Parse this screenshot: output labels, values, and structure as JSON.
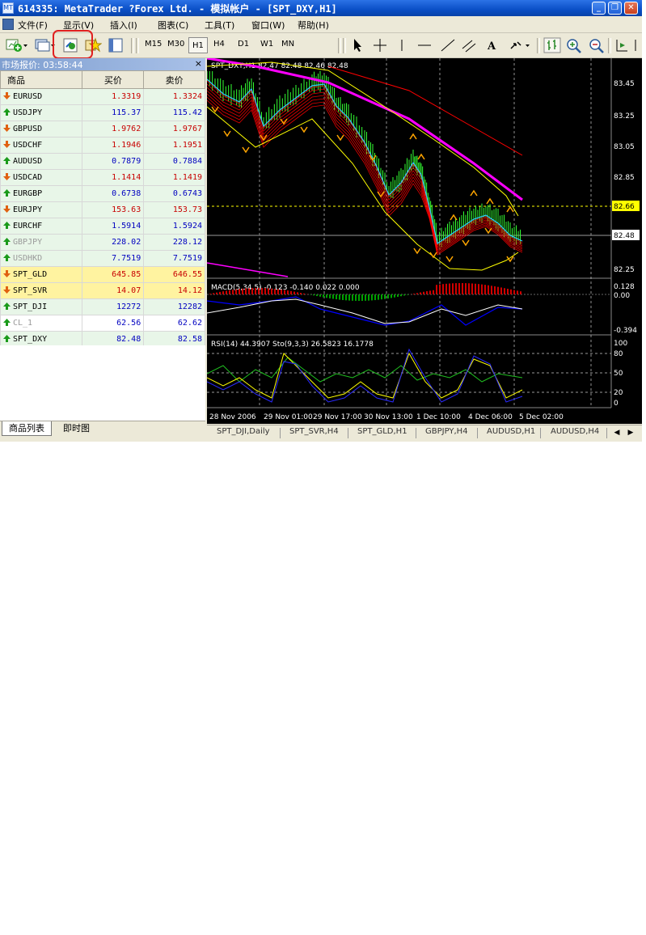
{
  "window": {
    "title": "614335: MetaTrader ?Forex Ltd. - 模拟帐户 - [SPT_DXY,H1]",
    "minimize_label": "_",
    "restore_label": "❐",
    "close_label": "✕"
  },
  "menu": [
    "文件(F)",
    "显示(V)",
    "插入(I)",
    "图表(C)",
    "工具(T)",
    "窗口(W)",
    "帮助(H)"
  ],
  "toolbar": {
    "timeframes": [
      "M15",
      "M30",
      "H1",
      "H4",
      "D1",
      "W1",
      "MN"
    ],
    "active_timeframe": "H1"
  },
  "market_watch": {
    "title": "市场报价: 03:58:44",
    "close_label": "×",
    "columns": [
      "商品",
      "买价",
      "卖价"
    ],
    "rows": [
      {
        "symbol": "EURUSD",
        "bid": "1.3319",
        "ask": "1.3324",
        "dir": "down",
        "color": "#c80000",
        "grey": false,
        "bg": "#e8f6e8"
      },
      {
        "symbol": "USDJPY",
        "bid": "115.37",
        "ask": "115.42",
        "dir": "up",
        "color": "#0000c0",
        "grey": false,
        "bg": "#e8f6e8"
      },
      {
        "symbol": "GBPUSD",
        "bid": "1.9762",
        "ask": "1.9767",
        "dir": "down",
        "color": "#c80000",
        "grey": false,
        "bg": "#e8f6e8"
      },
      {
        "symbol": "USDCHF",
        "bid": "1.1946",
        "ask": "1.1951",
        "dir": "down",
        "color": "#c80000",
        "grey": false,
        "bg": "#e8f6e8"
      },
      {
        "symbol": "AUDUSD",
        "bid": "0.7879",
        "ask": "0.7884",
        "dir": "up",
        "color": "#0000c0",
        "grey": false,
        "bg": "#e8f6e8"
      },
      {
        "symbol": "USDCAD",
        "bid": "1.1414",
        "ask": "1.1419",
        "dir": "down",
        "color": "#c80000",
        "grey": false,
        "bg": "#e8f6e8"
      },
      {
        "symbol": "EURGBP",
        "bid": "0.6738",
        "ask": "0.6743",
        "dir": "up",
        "color": "#0000c0",
        "grey": false,
        "bg": "#e8f6e8"
      },
      {
        "symbol": "EURJPY",
        "bid": "153.63",
        "ask": "153.73",
        "dir": "down",
        "color": "#c80000",
        "grey": false,
        "bg": "#e8f6e8"
      },
      {
        "symbol": "EURCHF",
        "bid": "1.5914",
        "ask": "1.5924",
        "dir": "up",
        "color": "#0000c0",
        "grey": false,
        "bg": "#e8f6e8"
      },
      {
        "symbol": "GBPJPY",
        "bid": "228.02",
        "ask": "228.12",
        "dir": "up",
        "color": "#0000c0",
        "grey": true,
        "bg": "#e8f6e8"
      },
      {
        "symbol": "USDHKD",
        "bid": "7.7519",
        "ask": "7.7519",
        "dir": "up",
        "color": "#0000c0",
        "grey": true,
        "bg": "#e8f6e8"
      },
      {
        "symbol": "SPT_GLD",
        "bid": "645.85",
        "ask": "646.55",
        "dir": "down",
        "color": "#c80000",
        "grey": false,
        "bg": "#fff3a0"
      },
      {
        "symbol": "SPT_SVR",
        "bid": "14.07",
        "ask": "14.12",
        "dir": "down",
        "color": "#c80000",
        "grey": false,
        "bg": "#fff3a0"
      },
      {
        "symbol": "SPT_DJI",
        "bid": "12272",
        "ask": "12282",
        "dir": "up",
        "color": "#0000c0",
        "grey": false,
        "bg": "#e8f6e8"
      },
      {
        "symbol": "CL_1",
        "bid": "62.56",
        "ask": "62.62",
        "dir": "up",
        "color": "#0000c0",
        "grey": true,
        "bg": "#ffffff"
      },
      {
        "symbol": "SPT_DXY",
        "bid": "82.48",
        "ask": "82.58",
        "dir": "up",
        "color": "#0000c0",
        "grey": false,
        "bg": "#e8f6e8"
      }
    ],
    "tabs": [
      "商品列表",
      "即时图"
    ]
  },
  "chart": {
    "main_label": "SPT_DXY,H1  82.47 82.48 82.46 82.48",
    "price_axis": [
      "83.45",
      "83.25",
      "83.05",
      "82.85",
      "82.66",
      "82.48",
      "82.25"
    ],
    "current_price": "82.48",
    "level_price": "82.66",
    "macd_label": "MACD(5,34,5) -0.123 -0.140 0.022 0.000",
    "macd_axis": [
      "0.128",
      "0.00",
      "-0.394"
    ],
    "rsi_label": "RSI(14) 44.3907  Sto(9,3,3) 26.5823 16.1778",
    "rsi_axis": [
      "100",
      "80",
      "50",
      "20",
      "0"
    ],
    "time_axis": [
      "28 Nov 2006",
      "29 Nov 01:00",
      "29 Nov 17:00",
      "30 Nov 13:00",
      "1 Dec 10:00",
      "4 Dec 06:00",
      "5 Dec 02:00"
    ],
    "colors": {
      "background": "#000000",
      "bull_candle": "#33ff33",
      "grid": "#cccccc",
      "envelope": "#ffff00",
      "ma_fast": "#33ccff",
      "ma_slow": "#ff0000",
      "magenta": "#ff00ff",
      "macd_line": "#0000ff",
      "signal_line": "#ffffff"
    }
  },
  "chart_tabs": [
    "SPT_DJI,Daily",
    "SPT_SVR,H4",
    "SPT_GLD,H1",
    "GBPJPY,H4",
    "AUDUSD,H1",
    "AUDUSD,H4"
  ]
}
